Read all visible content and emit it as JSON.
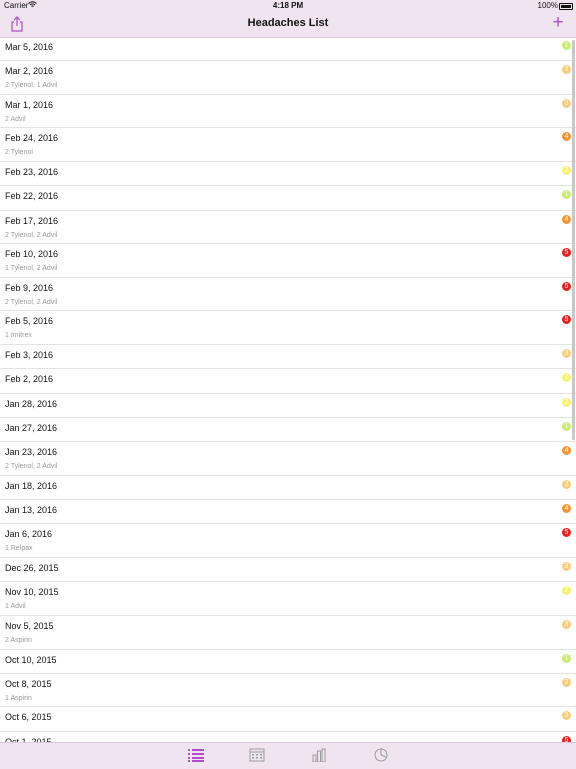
{
  "status_bar": {
    "carrier": "Carrier",
    "time": "4:18 PM",
    "battery": "100%"
  },
  "nav": {
    "title": "Headaches List",
    "share_icon": "share-icon",
    "add_icon": "plus-icon",
    "add_label": "+"
  },
  "colors": {
    "accent": "#b04ec8",
    "bar_bg": "#f0e4f1",
    "sev1": "#c6ee77",
    "sev2": "#f5f177",
    "sev3": "#f8cc80",
    "sev4": "#f09437",
    "sev5": "#e32222"
  },
  "entries": [
    {
      "date": "Mar 5, 2016",
      "meds": "",
      "severity": "1"
    },
    {
      "date": "Mar 2, 2016",
      "meds": "2 Tylenol, 1 Advil",
      "severity": "3"
    },
    {
      "date": "Mar 1, 2016",
      "meds": "2 Advil",
      "severity": "3"
    },
    {
      "date": "Feb 24, 2016",
      "meds": "2 Tylenol",
      "severity": "4"
    },
    {
      "date": "Feb 23, 2016",
      "meds": "",
      "severity": "2"
    },
    {
      "date": "Feb 22, 2016",
      "meds": "",
      "severity": "1"
    },
    {
      "date": "Feb 17, 2016",
      "meds": "2 Tylenol, 2 Advil",
      "severity": "4"
    },
    {
      "date": "Feb 10, 2016",
      "meds": "1 Tylenol, 2 Advil",
      "severity": "5"
    },
    {
      "date": "Feb 9, 2016",
      "meds": "2 Tylenol, 2 Advil",
      "severity": "5"
    },
    {
      "date": "Feb 5, 2016",
      "meds": "1 Imitrex",
      "severity": "5"
    },
    {
      "date": "Feb 3, 2016",
      "meds": "",
      "severity": "3"
    },
    {
      "date": "Feb 2, 2016",
      "meds": "",
      "severity": "2"
    },
    {
      "date": "Jan 28, 2016",
      "meds": "",
      "severity": "2"
    },
    {
      "date": "Jan 27, 2016",
      "meds": "",
      "severity": "1"
    },
    {
      "date": "Jan 23, 2016",
      "meds": "2 Tylenol, 2 Advil",
      "severity": "4"
    },
    {
      "date": "Jan 18, 2016",
      "meds": "",
      "severity": "3"
    },
    {
      "date": "Jan 13, 2016",
      "meds": "",
      "severity": "4"
    },
    {
      "date": "Jan 6, 2016",
      "meds": "1 Relpax",
      "severity": "5"
    },
    {
      "date": "Dec 26, 2015",
      "meds": "",
      "severity": "3"
    },
    {
      "date": "Nov 10, 2015",
      "meds": "1 Advil",
      "severity": "2"
    },
    {
      "date": "Nov 5, 2015",
      "meds": "2 Aspirin",
      "severity": "3"
    },
    {
      "date": "Oct 10, 2015",
      "meds": "",
      "severity": "1"
    },
    {
      "date": "Oct 8, 2015",
      "meds": "1 Aspirin",
      "severity": "3"
    },
    {
      "date": "Oct 6, 2015",
      "meds": "",
      "severity": "3"
    },
    {
      "date": "Oct 1, 2015",
      "meds": "",
      "severity": "5"
    }
  ],
  "tab_bar": {
    "tabs": [
      {
        "icon": "list-icon",
        "active": true
      },
      {
        "icon": "calendar-icon",
        "active": false
      },
      {
        "icon": "bar-chart-icon",
        "active": false
      },
      {
        "icon": "pie-chart-icon",
        "active": false
      }
    ]
  }
}
